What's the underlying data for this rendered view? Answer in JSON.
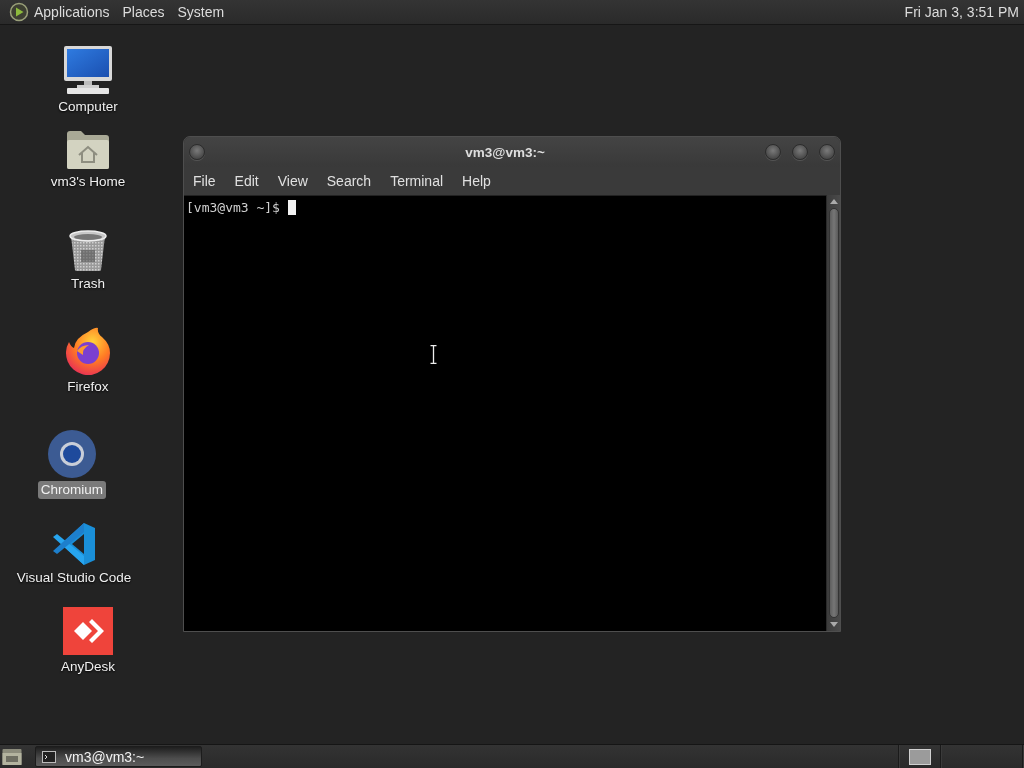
{
  "top_panel": {
    "menus": [
      "Applications",
      "Places",
      "System"
    ],
    "clock": "Fri Jan 3, 3:51 PM"
  },
  "desktop_icons": [
    {
      "label": "Computer",
      "kind": "monitor",
      "selected": false
    },
    {
      "label": "vm3's Home",
      "kind": "folder",
      "selected": false
    },
    {
      "label": "Trash",
      "kind": "bin",
      "selected": false
    },
    {
      "label": "Firefox",
      "kind": "flame",
      "selected": false
    },
    {
      "label": "Chromium",
      "kind": "ring",
      "selected": true
    },
    {
      "label": "Visual Studio Code",
      "kind": "ribbon",
      "selected": false
    },
    {
      "label": "AnyDesk",
      "kind": "diamond",
      "selected": false
    }
  ],
  "terminal_window": {
    "title": "vm3@vm3:~",
    "menu": [
      "File",
      "Edit",
      "View",
      "Search",
      "Terminal",
      "Help"
    ],
    "prompt": "[vm3@vm3 ~]$"
  },
  "taskbar": {
    "tasks": [
      {
        "label": "vm3@vm3:~",
        "selected": true
      }
    ]
  }
}
